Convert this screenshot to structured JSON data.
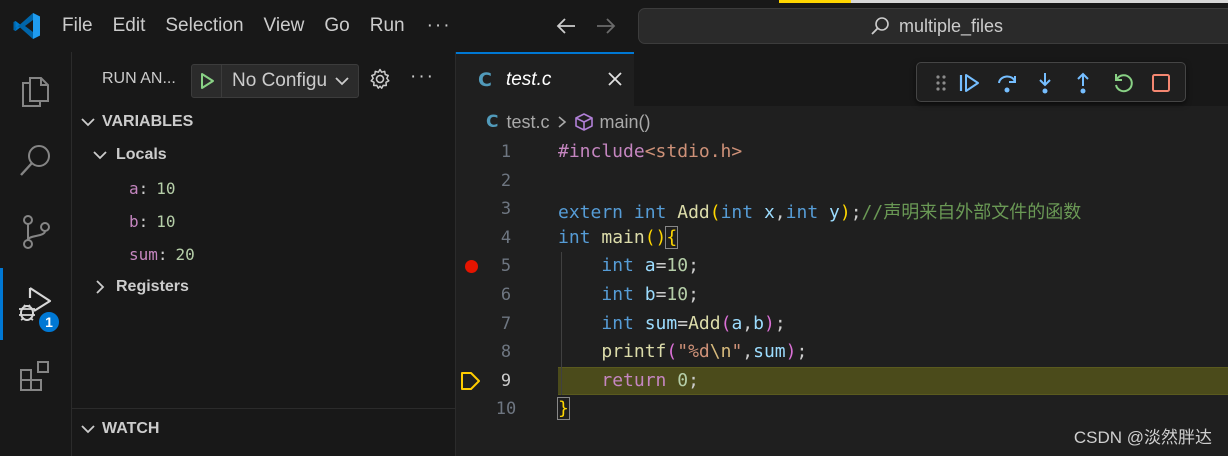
{
  "titlebar": {
    "menu": [
      "File",
      "Edit",
      "Selection",
      "View",
      "Go",
      "Run"
    ],
    "more": "···",
    "search_text": "multiple_files"
  },
  "activity": {
    "debug_badge": "1"
  },
  "sidebar": {
    "run_title": "RUN AN...",
    "config_label": "No Configu",
    "more": "···",
    "variables_title": "VARIABLES",
    "locals_title": "Locals",
    "locals": [
      {
        "name": "a",
        "value": "10"
      },
      {
        "name": "b",
        "value": "10"
      },
      {
        "name": "sum",
        "value": "20"
      }
    ],
    "registers_title": "Registers",
    "watch_title": "WATCH"
  },
  "editor": {
    "tab_icon": "C",
    "tab_label": "test.c",
    "breadcrumb": {
      "file_icon": "C",
      "file": "test.c",
      "symbol": "main()"
    },
    "line_numbers": [
      "1",
      "2",
      "3",
      "4",
      "5",
      "6",
      "7",
      "8",
      "9",
      "10"
    ],
    "current_line": "9",
    "breakpoint_line": "5",
    "code": {
      "l1_include": "#include",
      "l1_header": "<stdio.h>",
      "l3_extern": "extern",
      "l3_int": "int",
      "l3_fn": "Add",
      "l3_int_x": "int",
      "l3_x": "x",
      "l3_int_y": "int",
      "l3_y": "y",
      "l3_comment": "//声明来自外部文件的函数",
      "l4_int": "int",
      "l4_fn": "main",
      "l5_int": "int",
      "l5_var": "a",
      "l5_num": "10",
      "l6_int": "int",
      "l6_var": "b",
      "l6_num": "10",
      "l7_int": "int",
      "l7_var": "sum",
      "l7_fn": "Add",
      "l7_a": "a",
      "l7_b": "b",
      "l8_fn": "printf",
      "l8_str1": "\"%d",
      "l8_esc": "\\n",
      "l8_str2": "\"",
      "l8_sum": "sum",
      "l9_return": "return",
      "l9_num": "0"
    }
  },
  "watermark": "CSDN @淡然胖达",
  "colors": {
    "accent": "#0078d4",
    "breakpoint": "#e51400",
    "current_line_bg": "#4b4b1b",
    "debug_continue": "#75beff",
    "debug_restart": "#89d185",
    "debug_stop": "#f48771"
  }
}
